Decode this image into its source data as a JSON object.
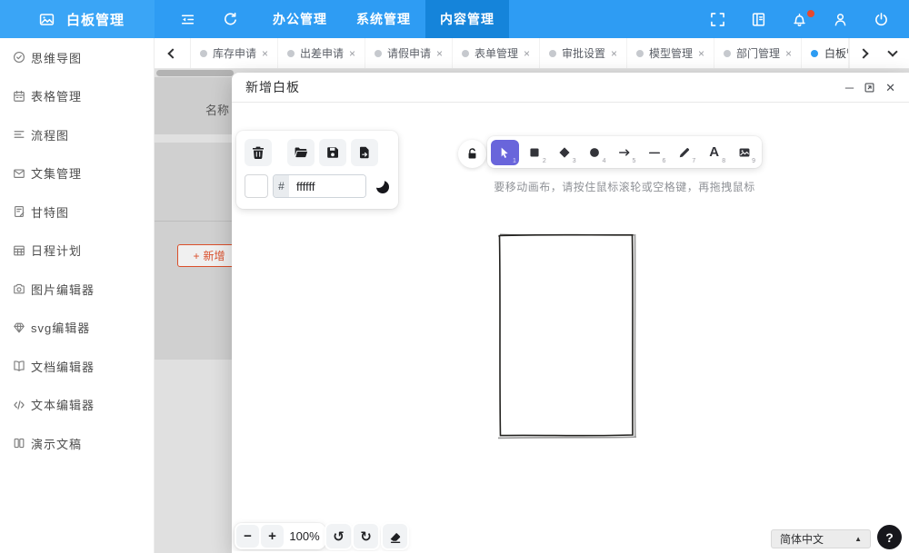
{
  "app": {
    "title": "白板管理"
  },
  "topnav": {
    "items": [
      {
        "label": "办公管理"
      },
      {
        "label": "系统管理"
      },
      {
        "label": "内容管理"
      }
    ],
    "active_index": 2
  },
  "sidebar": {
    "items": [
      {
        "icon": "check-circle-icon",
        "label": "思维导图"
      },
      {
        "icon": "calendar-icon",
        "label": "表格管理"
      },
      {
        "icon": "flow-lines-icon",
        "label": "流程图"
      },
      {
        "icon": "mail-icon",
        "label": "文集管理"
      },
      {
        "icon": "doc-edit-icon",
        "label": "甘特图"
      },
      {
        "icon": "grid-icon",
        "label": "日程计划"
      },
      {
        "icon": "camera-icon",
        "label": "图片编辑器"
      },
      {
        "icon": "gem-icon",
        "label": "svg编辑器"
      },
      {
        "icon": "book-icon",
        "label": "文档编辑器"
      },
      {
        "icon": "code-icon",
        "label": "文本编辑器"
      },
      {
        "icon": "columns-icon",
        "label": "演示文稿"
      }
    ]
  },
  "tabs": {
    "items": [
      {
        "label": "库存申请"
      },
      {
        "label": "出差申请"
      },
      {
        "label": "请假申请"
      },
      {
        "label": "表单管理"
      },
      {
        "label": "审批设置"
      },
      {
        "label": "模型管理"
      },
      {
        "label": "部门管理"
      },
      {
        "label": "白板管理"
      }
    ],
    "active_index": 7
  },
  "page": {
    "table_header": "名称",
    "add_label": "新增"
  },
  "modal": {
    "title": "新增白板"
  },
  "board": {
    "hex_prefix": "#",
    "hex_value": "ffffff",
    "hint": "要移动画布，请按住鼠标滚轮或空格键，再拖拽鼠标",
    "tools": [
      {
        "name": "selection",
        "num": "1"
      },
      {
        "name": "rectangle",
        "num": "2"
      },
      {
        "name": "diamond",
        "num": "3"
      },
      {
        "name": "ellipse",
        "num": "4"
      },
      {
        "name": "arrow",
        "num": "5"
      },
      {
        "name": "line",
        "num": "6"
      },
      {
        "name": "draw",
        "num": "7"
      },
      {
        "name": "text",
        "num": "8"
      },
      {
        "name": "image",
        "num": "9"
      }
    ],
    "zoom_level": "100%",
    "language": "简体中文"
  },
  "icons": {
    "plus": "+",
    "tab_close": "×",
    "window_minimize": "─",
    "window_close": "✕",
    "zoom_out": "−",
    "zoom_in": "+",
    "undo": "↺",
    "redo": "↻",
    "dropdown_up": "▲",
    "help": "?",
    "text_tool": "A"
  },
  "colors": {
    "header_blue": "#2e9cf3",
    "active_nav_blue": "#1584da",
    "tool_active_purple": "#6965db",
    "add_button_orange": "#e6542e"
  }
}
